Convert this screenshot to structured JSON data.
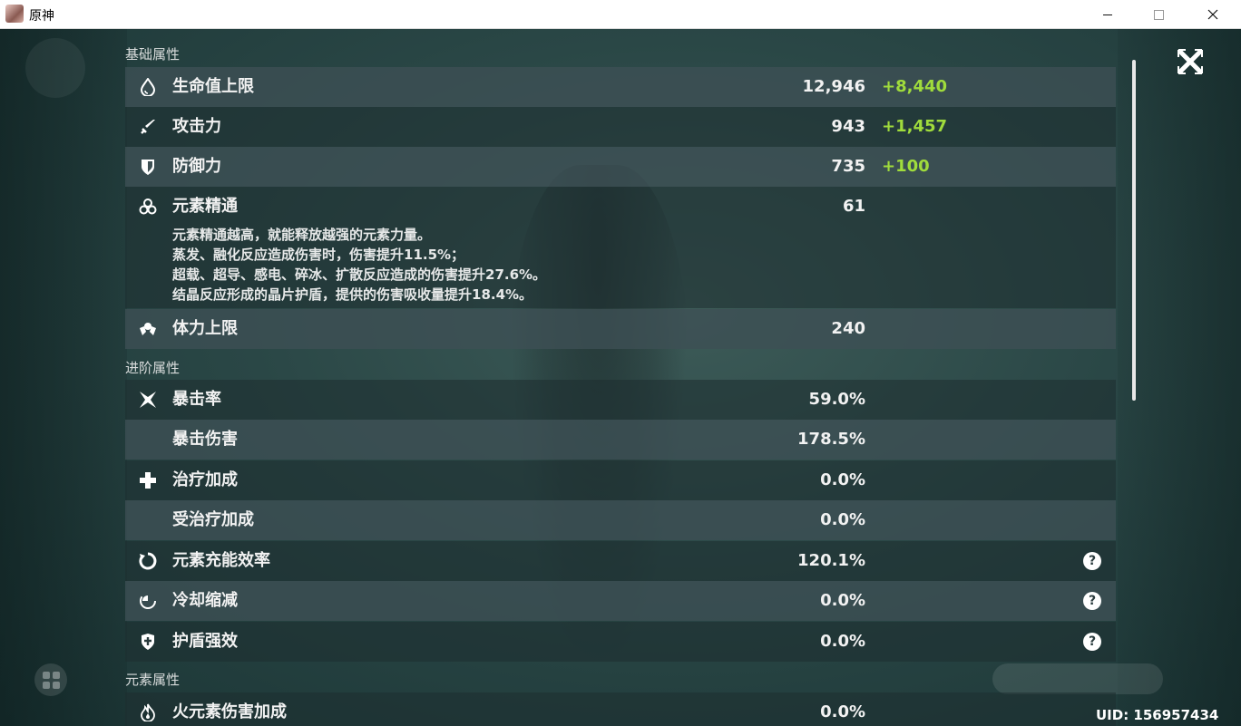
{
  "window": {
    "title": "原神"
  },
  "sections": {
    "basic": "基础属性",
    "advanced": "进阶属性",
    "elemental": "元素属性"
  },
  "basic_stats": [
    {
      "label": "生命值上限",
      "value": "12,946",
      "bonus": "+8,440",
      "icon": "hp-drop-icon"
    },
    {
      "label": "攻击力",
      "value": "943",
      "bonus": "+1,457",
      "icon": "sword-icon"
    },
    {
      "label": "防御力",
      "value": "735",
      "bonus": "+100",
      "icon": "shield-icon"
    },
    {
      "label": "元素精通",
      "value": "61",
      "bonus": "",
      "icon": "elemental-mastery-icon"
    },
    {
      "label": "体力上限",
      "value": "240",
      "bonus": "",
      "icon": "stamina-icon"
    }
  ],
  "mastery_description": [
    "元素精通越高，就能释放越强的元素力量。",
    "蒸发、融化反应造成伤害时，伤害提升11.5%；",
    "超载、超导、感电、碎冰、扩散反应造成的伤害提升27.6%。",
    "结晶反应形成的晶片护盾，提供的伤害吸收量提升18.4%。"
  ],
  "advanced_stats": [
    {
      "label": "暴击率",
      "value": "59.0%",
      "icon": "crit-star-icon"
    },
    {
      "label": "暴击伤害",
      "value": "178.5%",
      "icon": ""
    },
    {
      "label": "治疗加成",
      "value": "0.0%",
      "icon": "healing-cross-icon"
    },
    {
      "label": "受治疗加成",
      "value": "0.0%",
      "icon": ""
    },
    {
      "label": "元素充能效率",
      "value": "120.1%",
      "icon": "energy-recharge-icon",
      "help": "?"
    },
    {
      "label": "冷却缩减",
      "value": "0.0%",
      "icon": "cooldown-icon",
      "help": "?"
    },
    {
      "label": "护盾强效",
      "value": "0.0%",
      "icon": "shield-strength-icon",
      "help": "?"
    }
  ],
  "elemental_stats": [
    {
      "label": "火元素伤害加成",
      "value": "0.0%",
      "icon": "pyro-flame-icon"
    }
  ],
  "uid": "UID: 156957434",
  "colors": {
    "bonus": "#a0dc3c",
    "row_shade": "#3e5054",
    "background": "#2a4746"
  }
}
